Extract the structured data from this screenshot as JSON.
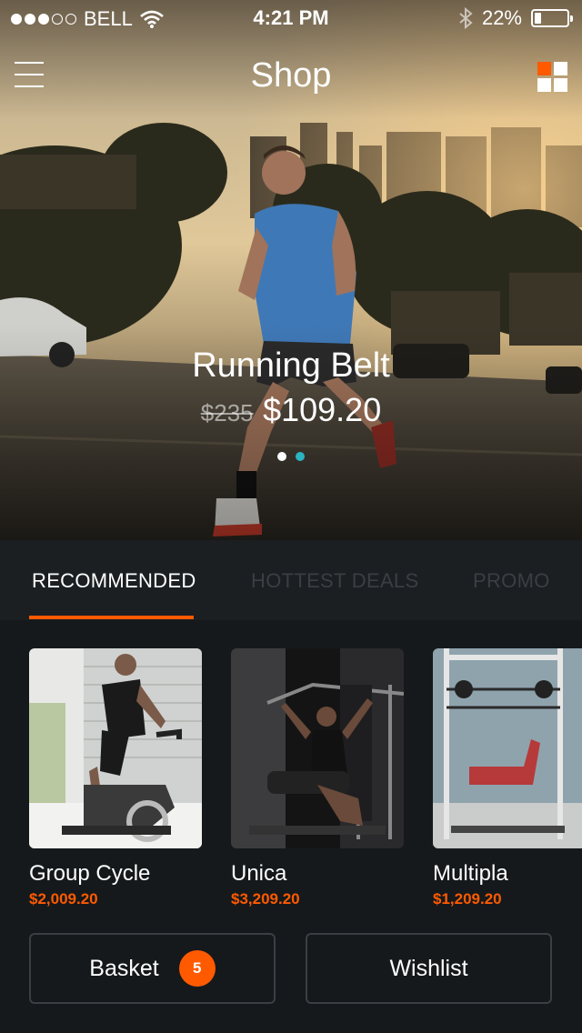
{
  "status_bar": {
    "carrier": "BELL",
    "time": "4:21 PM",
    "battery": "22%",
    "battery_level": 0.22,
    "signal_filled": 3,
    "signal_total": 5
  },
  "navbar": {
    "title": "Shop",
    "menu_icon": "hamburger-menu-icon",
    "grid_icon": "grid-view-icon"
  },
  "hero": {
    "title": "Running Belt",
    "old_price": "$235",
    "new_price": "$109.20",
    "slides": 2,
    "active_slide": 2
  },
  "tabs": [
    {
      "label": "RECOMMENDED",
      "active": true
    },
    {
      "label": "HOTTEST DEALS",
      "active": false
    },
    {
      "label": "PROMO",
      "active": false
    }
  ],
  "products": [
    {
      "name": "Group Cycle",
      "price": "$2,009.20"
    },
    {
      "name": "Unica",
      "price": "$3,209.20"
    },
    {
      "name": "Multipla",
      "price": "$1,209.20"
    }
  ],
  "actions": {
    "basket_label": "Basket",
    "basket_count": "5",
    "wishlist_label": "Wishlist"
  },
  "colors": {
    "accent": "#ff5a00",
    "pager_active": "#2bb3c0",
    "background": "#15191c"
  }
}
